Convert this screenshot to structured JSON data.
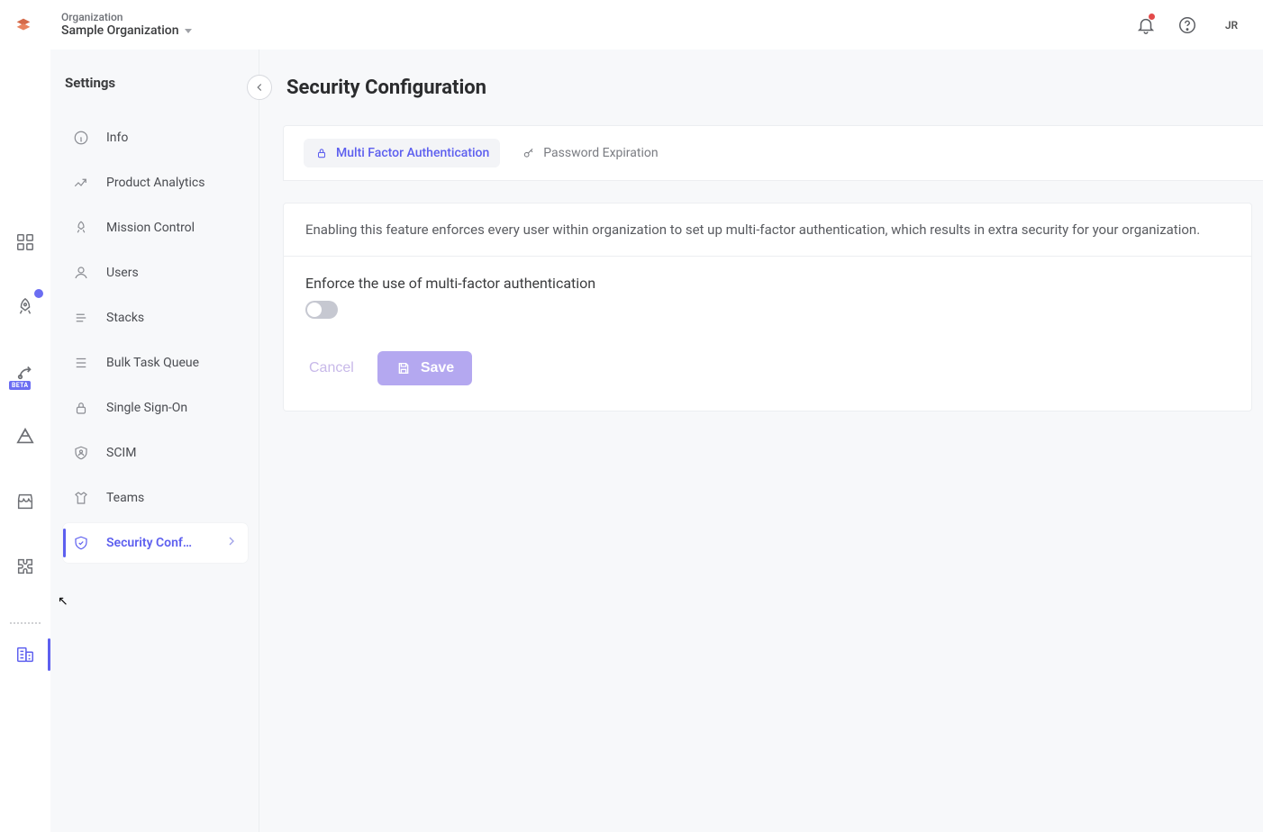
{
  "header": {
    "org_label": "Organization",
    "org_name": "Sample Organization",
    "user_initials": "JR"
  },
  "rail": {
    "items": [
      {
        "name": "dashboard",
        "icon": "grid"
      },
      {
        "name": "launch",
        "icon": "rocket",
        "dot": true
      },
      {
        "name": "devloop",
        "icon": "dp",
        "beta_label": "BETA"
      },
      {
        "name": "automate",
        "icon": "triangle"
      },
      {
        "name": "marketplace",
        "icon": "store"
      },
      {
        "name": "integrations",
        "icon": "puzzle"
      }
    ],
    "footer_item": {
      "name": "org-settings",
      "icon": "building",
      "active": true
    }
  },
  "subnav": {
    "title": "Settings",
    "items": [
      {
        "label": "Info",
        "icon": "info"
      },
      {
        "label": "Product Analytics",
        "icon": "analytics"
      },
      {
        "label": "Mission Control",
        "icon": "mission"
      },
      {
        "label": "Users",
        "icon": "user"
      },
      {
        "label": "Stacks",
        "icon": "stacks"
      },
      {
        "label": "Bulk Task Queue",
        "icon": "queue"
      },
      {
        "label": "Single Sign-On",
        "icon": "lock"
      },
      {
        "label": "SCIM",
        "icon": "shield-user"
      },
      {
        "label": "Teams",
        "icon": "shirt"
      },
      {
        "label": "Security Conf…",
        "icon": "shield-check",
        "active": true
      }
    ]
  },
  "main": {
    "page_title": "Security Configuration",
    "tabs": [
      {
        "label": "Multi Factor Authentication",
        "icon": "lock",
        "active": true
      },
      {
        "label": "Password Expiration",
        "icon": "key"
      }
    ],
    "panel": {
      "description": "Enabling this feature enforces every user within organization to set up multi-factor authentication, which results in extra security for your organization.",
      "toggle_label": "Enforce the use of multi-factor authentication",
      "toggle_state": "off",
      "cancel_label": "Cancel",
      "save_label": "Save"
    }
  },
  "colors": {
    "accent": "#5d5fef",
    "accent_soft": "#b4a8f0"
  }
}
